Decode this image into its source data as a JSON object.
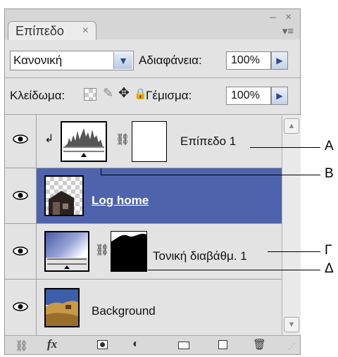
{
  "panel": {
    "tab_label": "Επίπεδο",
    "tab_close": "×",
    "minimize": "–",
    "close": "×",
    "menu": "▾≡"
  },
  "blend": {
    "mode": "Κανονική",
    "opacity_label": "Αδιαφάνεια:",
    "opacity_value": "100%"
  },
  "lock": {
    "label": "Κλείδωμα:",
    "fill_label": "Γέμισμα:",
    "fill_value": "100%"
  },
  "layers": [
    {
      "name": "Επίπεδο 1",
      "selected": false
    },
    {
      "name": "Log home",
      "selected": true
    },
    {
      "name": "Τονική διαβάθμ. 1",
      "selected": false
    },
    {
      "name": "Background",
      "selected": false
    }
  ],
  "callouts": {
    "a": "A",
    "b": "B",
    "c": "Γ",
    "d": "Δ"
  },
  "colors": {
    "selection": "#4f63ad",
    "panel": "#e3e3e3"
  },
  "icons": [
    "eye-icon",
    "link-icon",
    "fx-icon",
    "mask-icon",
    "adjustment-icon",
    "folder-icon",
    "new-layer-icon",
    "trash-icon"
  ]
}
